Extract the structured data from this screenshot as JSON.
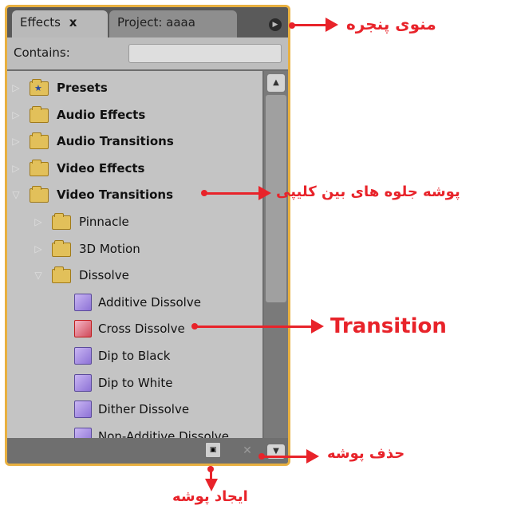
{
  "tabs": {
    "effects": "Effects",
    "effects_close": "x",
    "project": "Project: aaaa"
  },
  "filter": {
    "contains_label": "Contains:",
    "search_value": ""
  },
  "tree": [
    {
      "label": "Presets",
      "bold": true,
      "expanded": false,
      "indent": 0,
      "icon": "presets-folder-icon"
    },
    {
      "label": "Audio Effects",
      "bold": true,
      "expanded": false,
      "indent": 0,
      "icon": "folder-icon"
    },
    {
      "label": "Audio Transitions",
      "bold": true,
      "expanded": false,
      "indent": 0,
      "icon": "folder-icon"
    },
    {
      "label": "Video Effects",
      "bold": true,
      "expanded": false,
      "indent": 0,
      "icon": "folder-icon"
    },
    {
      "label": "Video Transitions",
      "bold": true,
      "expanded": true,
      "indent": 0,
      "icon": "folder-icon"
    },
    {
      "label": "Pinnacle",
      "bold": false,
      "expanded": false,
      "indent": 1,
      "icon": "folder-icon"
    },
    {
      "label": "3D Motion",
      "bold": false,
      "expanded": false,
      "indent": 1,
      "icon": "folder-icon"
    },
    {
      "label": "Dissolve",
      "bold": false,
      "expanded": true,
      "indent": 1,
      "icon": "folder-icon"
    },
    {
      "label": "Additive Dissolve",
      "indent": 2,
      "icon": "transition-icon"
    },
    {
      "label": "Cross Dissolve",
      "indent": 2,
      "icon": "default-transition-icon"
    },
    {
      "label": "Dip to Black",
      "indent": 2,
      "icon": "transition-icon"
    },
    {
      "label": "Dip to White",
      "indent": 2,
      "icon": "transition-icon"
    },
    {
      "label": "Dither Dissolve",
      "indent": 2,
      "icon": "transition-icon"
    },
    {
      "label": "Non-Additive Dissolve",
      "indent": 2,
      "icon": "transition-icon"
    }
  ],
  "annotations": {
    "panel_menu": "منوی پنجره",
    "transitions_folder": "پوشه جلوه های بین کلیپی",
    "transition": "Transition",
    "delete_folder": "حذف پوشه",
    "new_folder": "ایجاد پوشه"
  },
  "colors": {
    "annotation": "#e8232a",
    "panel_border": "#e8b040"
  }
}
